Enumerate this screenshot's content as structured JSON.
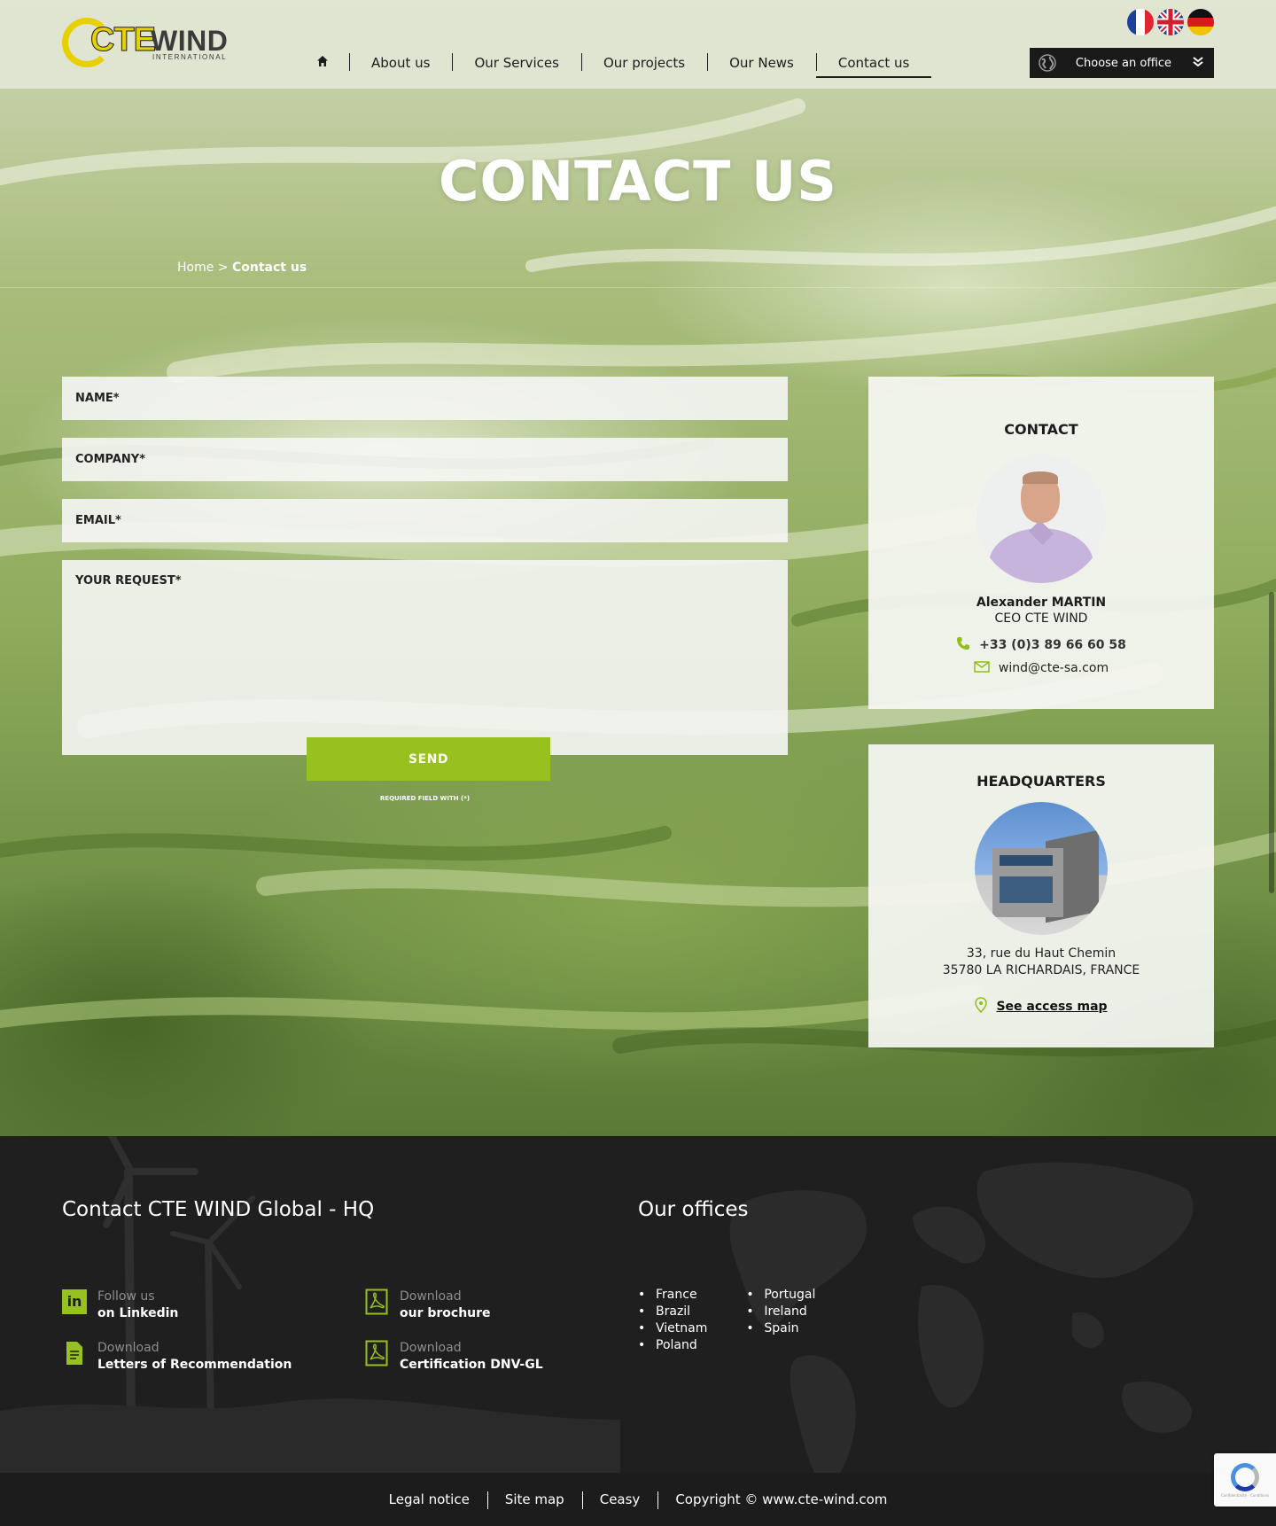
{
  "header": {
    "logo_mark": "CTE",
    "logo_text": "WIND",
    "logo_subtext": "INTERNATIONAL",
    "nav": [
      "About us",
      "Our Services",
      "Our projects",
      "Our News",
      "Contact us"
    ],
    "active_nav": "Contact us",
    "office_select_label": "Choose an office",
    "languages": [
      "French",
      "English",
      "German"
    ]
  },
  "page": {
    "title": "CONTACT US",
    "breadcrumb_home": "Home",
    "breadcrumb_sep": ">",
    "breadcrumb_current": "Contact us"
  },
  "form": {
    "name_placeholder": "NAME*",
    "company_placeholder": "COMPANY*",
    "email_placeholder": "EMAIL*",
    "request_placeholder": "YOUR REQUEST*",
    "send_label": "SEND",
    "required_note": "REQUIRED FIELD WITH (*)"
  },
  "contact_card": {
    "title": "CONTACT",
    "name": "Alexander MARTIN",
    "role": "CEO CTE WIND",
    "phone": "+33 (0)3 89 66 60 58",
    "email": "wind@cte-sa.com"
  },
  "hq_card": {
    "title": "HEADQUARTERS",
    "address_line1": "33, rue du Haut Chemin",
    "address_line2": "35780 LA RICHARDAIS, FRANCE",
    "map_link": "See access map"
  },
  "footer": {
    "contact_title": "Contact CTE WIND Global - HQ",
    "offices_title": "Our offices",
    "links": [
      {
        "small": "Follow us",
        "big": "on Linkedin"
      },
      {
        "small": "Download",
        "big": "our brochure"
      },
      {
        "small": "Download",
        "big": "Letters of Recommendation"
      },
      {
        "small": "Download",
        "big": "Certification DNV-GL"
      }
    ],
    "offices_col1": [
      "France",
      "Brazil",
      "Vietnam",
      "Poland"
    ],
    "offices_col2": [
      "Portugal",
      "Ireland",
      "Spain"
    ],
    "bottom_links": [
      "Legal notice",
      "Site map",
      "Ceasy",
      "Copyright © www.cte-wind.com"
    ]
  },
  "recaptcha": {
    "text": "Confidentialité - Conditions"
  },
  "colors": {
    "accent_green": "#96c11f",
    "logo_yellow": "#e6d000",
    "footer_bg": "#1f1f1f"
  }
}
